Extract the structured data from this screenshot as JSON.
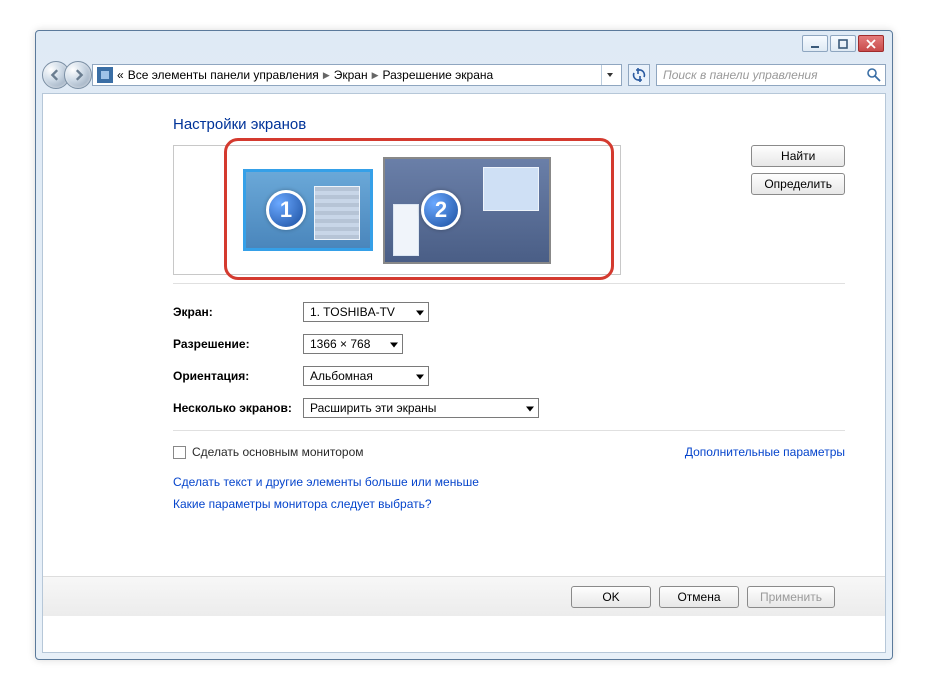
{
  "breadcrumb": {
    "prefix": "«",
    "item1": "Все элементы панели управления",
    "item2": "Экран",
    "item3": "Разрешение экрана"
  },
  "search": {
    "placeholder": "Поиск в панели управления"
  },
  "page_title": "Настройки экранов",
  "monitors": {
    "n1": "1",
    "n2": "2"
  },
  "side_buttons": {
    "find": "Найти",
    "identify": "Определить"
  },
  "fields": {
    "display_label": "Экран:",
    "display_value": "1. TOSHIBA-TV",
    "resolution_label": "Разрешение:",
    "resolution_value": "1366 × 768",
    "orientation_label": "Ориентация:",
    "orientation_value": "Альбомная",
    "multi_label": "Несколько экранов:",
    "multi_value": "Расширить эти экраны"
  },
  "make_primary": "Сделать основным монитором",
  "advanced": "Дополнительные параметры",
  "link1": "Сделать текст и другие элементы больше или меньше",
  "link2": "Какие параметры монитора следует выбрать?",
  "buttons": {
    "ok": "OK",
    "cancel": "Отмена",
    "apply": "Применить"
  }
}
